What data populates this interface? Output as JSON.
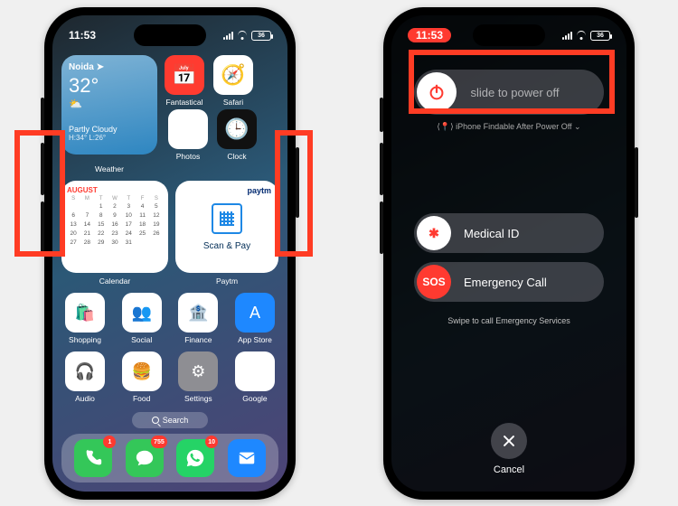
{
  "status": {
    "time": "11:53",
    "battery": "36",
    "signal_icon": "signal-icon",
    "wifi_icon": "wifi-icon"
  },
  "left": {
    "widgets": {
      "weather": {
        "city": "Noida",
        "arrow": "➤",
        "temp": "32°",
        "condition": "Partly Cloudy",
        "hilo": "H:34° L:26°",
        "label": "Weather"
      },
      "calendar": {
        "month": "AUGUST",
        "label": "Calendar",
        "days": [
          "S",
          "M",
          "T",
          "W",
          "T",
          "F",
          "S"
        ],
        "dates": [
          "",
          "",
          "1",
          "2",
          "3",
          "4",
          "5",
          "6",
          "7",
          "8",
          "9",
          "10",
          "11",
          "12",
          "13",
          "14",
          "15",
          "16",
          "17",
          "18",
          "19",
          "20",
          "21",
          "22",
          "23",
          "24",
          "25",
          "26",
          "27",
          "28",
          "29",
          "30",
          "31"
        ]
      },
      "paytm": {
        "logo": "paytm",
        "caption": "Scan & Pay",
        "label": "Paytm"
      }
    },
    "apps_row1a": [
      {
        "label": "Fantastical",
        "icon": "📅",
        "bg": "#ff3b30"
      },
      {
        "label": "Safari",
        "icon": "🧭",
        "bg": "#fff"
      }
    ],
    "apps_row1b": [
      {
        "label": "Photos",
        "icon": "❋",
        "bg": "#fff"
      },
      {
        "label": "Clock",
        "icon": "🕒",
        "bg": "#111"
      }
    ],
    "apps_row3": [
      {
        "label": "Shopping",
        "icon": "🛍️",
        "bg": "#fff"
      },
      {
        "label": "Social",
        "icon": "👥",
        "bg": "#fff"
      },
      {
        "label": "Finance",
        "icon": "🏦",
        "bg": "#fff"
      },
      {
        "label": "App Store",
        "icon": "A",
        "bg": "#1e88ff"
      }
    ],
    "apps_row4": [
      {
        "label": "Audio",
        "icon": "🎧",
        "bg": "#fff"
      },
      {
        "label": "Food",
        "icon": "🍔",
        "bg": "#fff"
      },
      {
        "label": "Settings",
        "icon": "⚙︎",
        "bg": "#8e8e93"
      },
      {
        "label": "Google",
        "icon": "G",
        "bg": "#fff"
      }
    ],
    "search": "Search",
    "dock": [
      {
        "name": "phone",
        "bg": "#34c759",
        "icon": "phone",
        "badge": "1"
      },
      {
        "name": "messages",
        "bg": "#34c759",
        "icon": "message",
        "badge": "755"
      },
      {
        "name": "whatsapp",
        "bg": "#25d366",
        "icon": "whatsapp",
        "badge": "10"
      },
      {
        "name": "mail",
        "bg": "#1e88ff",
        "icon": "mail",
        "badge": null
      }
    ]
  },
  "right": {
    "power_slider": "slide to power off",
    "findable": "iPhone Findable After Power Off",
    "medical": {
      "knob": "✱",
      "label": "Medical ID"
    },
    "sos": {
      "knob": "SOS",
      "label": "Emergency Call"
    },
    "swipe": "Swipe to call Emergency Services",
    "cancel": "Cancel"
  }
}
